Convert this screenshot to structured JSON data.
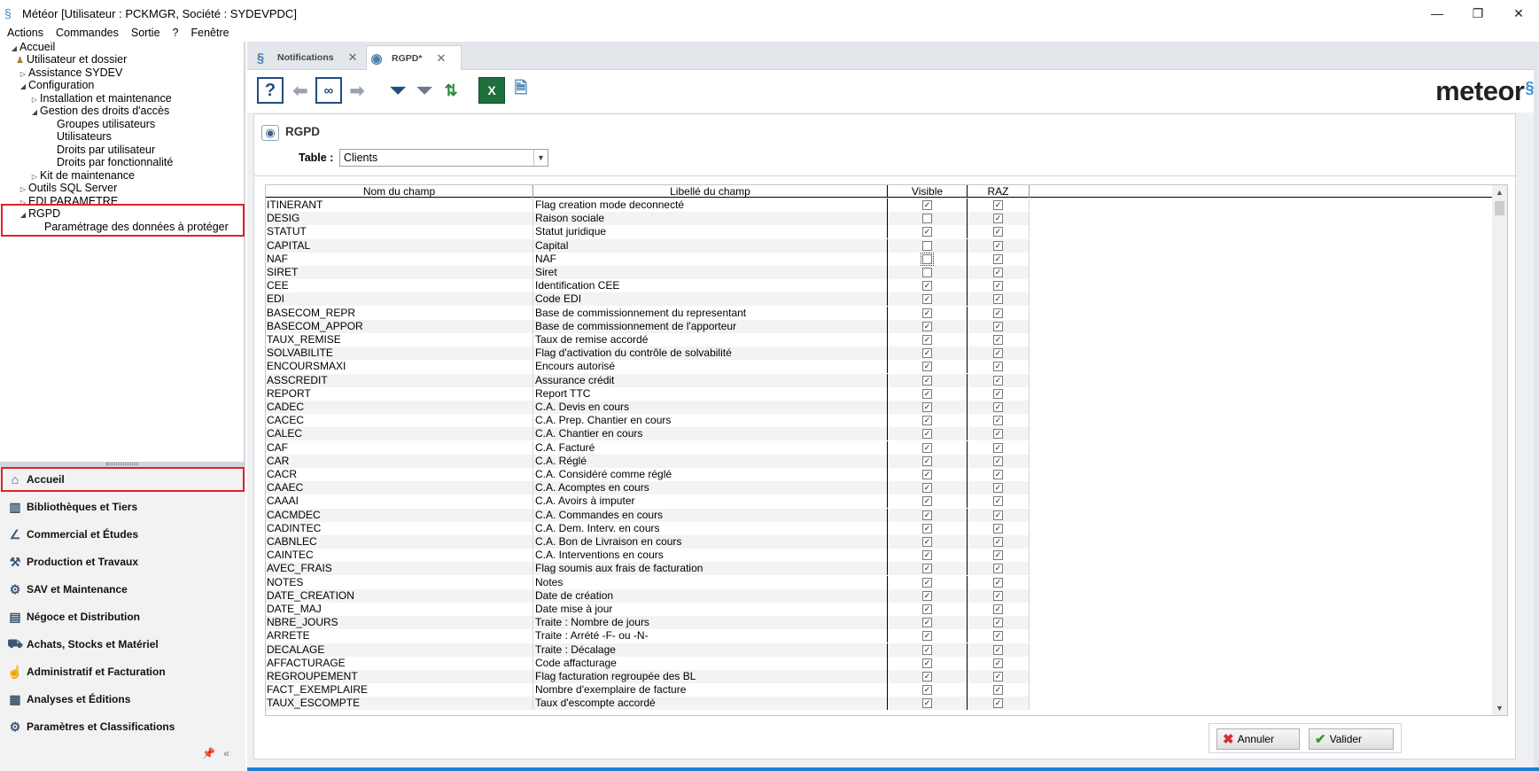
{
  "window": {
    "title": "Météor [Utilisateur : PCKMGR, Société : SYDEVPDC]"
  },
  "menu": [
    "Actions",
    "Commandes",
    "Sortie",
    "?",
    "Fenêtre"
  ],
  "tree": {
    "root": "Accueil",
    "users_folder": "Utilisateur et dossier",
    "assistance": "Assistance SYDEV",
    "configuration": "Configuration",
    "installation": "Installation et maintenance",
    "droits": "Gestion des droits d'accès",
    "groupes": "Groupes utilisateurs",
    "utilisateurs": "Utilisateurs",
    "droits_user": "Droits par utilisateur",
    "droits_fonct": "Droits par fonctionnalité",
    "kit": "Kit de maintenance",
    "outils_sql": "Outils SQL Server",
    "edi": "EDI PARAMETRE",
    "rgpd": "RGPD",
    "parametrage": "Paramétrage des données à protéger"
  },
  "modules": [
    {
      "label": "Accueil",
      "icon": "home-icon",
      "glyph": "⌂"
    },
    {
      "label": "Bibliothèques et Tiers",
      "icon": "books-icon",
      "glyph": "▥"
    },
    {
      "label": "Commercial et Études",
      "icon": "compass-icon",
      "glyph": "∠"
    },
    {
      "label": "Production et Travaux",
      "icon": "worker-icon",
      "glyph": "⚒"
    },
    {
      "label": "SAV et Maintenance",
      "icon": "gear-icon",
      "glyph": "⚙"
    },
    {
      "label": "Négoce et Distribution",
      "icon": "book-icon",
      "glyph": "▤"
    },
    {
      "label": "Achats, Stocks et Matériel",
      "icon": "cart-icon",
      "glyph": "⛟"
    },
    {
      "label": "Administratif et Facturation",
      "icon": "hand-icon",
      "glyph": "☝"
    },
    {
      "label": "Analyses et Éditions",
      "icon": "report-icon",
      "glyph": "▦"
    },
    {
      "label": "Paramètres et Classifications",
      "icon": "settings-icon",
      "glyph": "⚙"
    }
  ],
  "tabs": [
    {
      "label": "Notifications"
    },
    {
      "label": "RGPD*"
    }
  ],
  "brand": "meteor",
  "section": {
    "title": "RGPD",
    "table_label": "Table :",
    "table_value": "Clients"
  },
  "grid": {
    "headers": [
      "Nom du champ",
      "Libellé du champ",
      "Visible",
      "RAZ"
    ],
    "rows": [
      {
        "name": "ITINERANT",
        "label": "Flag creation mode deconnecté",
        "visible": true,
        "raz": true
      },
      {
        "name": "DESIG",
        "label": "Raison sociale",
        "visible": false,
        "raz": true
      },
      {
        "name": "STATUT",
        "label": "Statut juridique",
        "visible": true,
        "raz": true
      },
      {
        "name": "CAPITAL",
        "label": "Capital",
        "visible": false,
        "raz": true
      },
      {
        "name": "NAF",
        "label": "NAF",
        "visible": false,
        "raz": true
      },
      {
        "name": "SIRET",
        "label": "Siret",
        "visible": false,
        "raz": true
      },
      {
        "name": "CEE",
        "label": "Identification CEE",
        "visible": true,
        "raz": true
      },
      {
        "name": "EDI",
        "label": "Code EDI",
        "visible": true,
        "raz": true
      },
      {
        "name": "BASECOM_REPR",
        "label": "Base de commissionnement du representant",
        "visible": true,
        "raz": true
      },
      {
        "name": "BASECOM_APPOR",
        "label": "Base de commissionnement de l'apporteur",
        "visible": true,
        "raz": true
      },
      {
        "name": "TAUX_REMISE",
        "label": "Taux de remise accordé",
        "visible": true,
        "raz": true
      },
      {
        "name": "SOLVABILITE",
        "label": "Flag d'activation du contrôle de solvabilité",
        "visible": true,
        "raz": true
      },
      {
        "name": "ENCOURSMAXI",
        "label": "Encours autorisé",
        "visible": true,
        "raz": true
      },
      {
        "name": "ASSCREDIT",
        "label": "Assurance crédit",
        "visible": true,
        "raz": true
      },
      {
        "name": "REPORT",
        "label": "Report TTC",
        "visible": true,
        "raz": true
      },
      {
        "name": "CADEC",
        "label": "C.A. Devis en cours",
        "visible": true,
        "raz": true
      },
      {
        "name": "CACEC",
        "label": "C.A. Prep. Chantier en cours",
        "visible": true,
        "raz": true
      },
      {
        "name": "CALEC",
        "label": "C.A. Chantier en cours",
        "visible": true,
        "raz": true
      },
      {
        "name": "CAF",
        "label": "C.A. Facturé",
        "visible": true,
        "raz": true
      },
      {
        "name": "CAR",
        "label": "C.A. Réglé",
        "visible": true,
        "raz": true
      },
      {
        "name": "CACR",
        "label": "C.A. Considéré comme réglé",
        "visible": true,
        "raz": true
      },
      {
        "name": "CAAEC",
        "label": "C.A. Acomptes en cours",
        "visible": true,
        "raz": true
      },
      {
        "name": "CAAAI",
        "label": "C.A. Avoirs à imputer",
        "visible": true,
        "raz": true
      },
      {
        "name": "CACMDEC",
        "label": "C.A. Commandes en cours",
        "visible": true,
        "raz": true
      },
      {
        "name": "CADINTEC",
        "label": "C.A. Dem. Interv. en cours",
        "visible": true,
        "raz": true
      },
      {
        "name": "CABNLEC",
        "label": "C.A. Bon de Livraison en cours",
        "visible": true,
        "raz": true
      },
      {
        "name": "CAINTEC",
        "label": "C.A. Interventions en cours",
        "visible": true,
        "raz": true
      },
      {
        "name": "AVEC_FRAIS",
        "label": "Flag soumis aux frais de facturation",
        "visible": true,
        "raz": true
      },
      {
        "name": "NOTES",
        "label": "Notes",
        "visible": true,
        "raz": true
      },
      {
        "name": "DATE_CREATION",
        "label": "Date de création",
        "visible": true,
        "raz": true
      },
      {
        "name": "DATE_MAJ",
        "label": "Date mise à jour",
        "visible": true,
        "raz": true
      },
      {
        "name": "NBRE_JOURS",
        "label": "Traite : Nombre de jours",
        "visible": true,
        "raz": true
      },
      {
        "name": "ARRETE",
        "label": "Traite : Arrété -F- ou -N-",
        "visible": true,
        "raz": true
      },
      {
        "name": "DECALAGE",
        "label": "Traite : Décalage",
        "visible": true,
        "raz": true
      },
      {
        "name": "AFFACTURAGE",
        "label": "Code affacturage",
        "visible": true,
        "raz": true
      },
      {
        "name": "REGROUPEMENT",
        "label": "Flag facturation regroupée des BL",
        "visible": true,
        "raz": true
      },
      {
        "name": "FACT_EXEMPLAIRE",
        "label": "Nombre d'exemplaire de facture",
        "visible": true,
        "raz": true
      },
      {
        "name": "TAUX_ESCOMPTE",
        "label": "Taux d'escompte accordé",
        "visible": true,
        "raz": true
      }
    ]
  },
  "buttons": {
    "cancel": "Annuler",
    "validate": "Valider"
  },
  "colors": {
    "highlight": "#e0202b",
    "accent": "#3a8ccc",
    "toolbar_icon": "#1f4e82"
  }
}
